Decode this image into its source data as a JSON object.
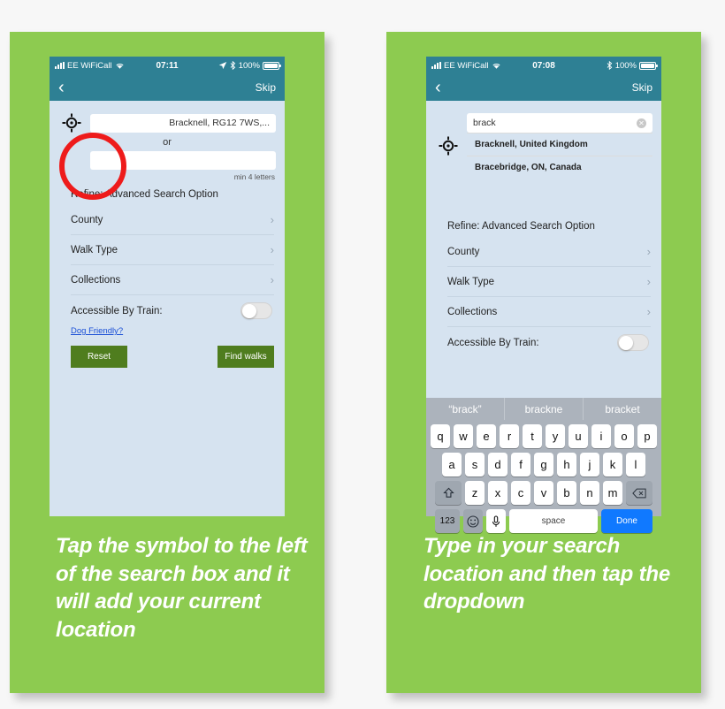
{
  "panels": [
    {
      "id": "left",
      "status_bar": {
        "carrier": "EE WiFiCall",
        "wifi_icon": "wifi-icon",
        "time": "07:11",
        "location_icon": "location-arrow-icon",
        "bluetooth_icon": "bluetooth-icon",
        "battery_text": "100%",
        "battery_icon": "battery-icon"
      },
      "nav": {
        "back_icon": "chevron-left-icon",
        "skip_label": "Skip"
      },
      "search": {
        "target_icon": "crosshair-target-icon",
        "location_value": "Bracknell, RG12 7WS,...",
        "or_label": "or",
        "second_input_value": "",
        "second_input_placeholder": "",
        "hint": "min 4 letters"
      },
      "refine_title": "Refine: Advanced Search Option",
      "rows": [
        {
          "label": "County",
          "chevron": "chevron-right-icon"
        },
        {
          "label": "Walk Type",
          "chevron": "chevron-right-icon"
        },
        {
          "label": "Collections",
          "chevron": "chevron-right-icon"
        }
      ],
      "train": {
        "label": "Accessible By Train:",
        "toggle_state": "off"
      },
      "dog_link": "Dog Friendly?",
      "buttons": {
        "reset": "Reset",
        "find": "Find walks"
      },
      "annotation": "red-highlight-circle",
      "caption": "Tap the symbol to the left of the search box and it will add your current location"
    },
    {
      "id": "right",
      "status_bar": {
        "carrier": "EE WiFiCall",
        "wifi_icon": "wifi-icon",
        "time": "07:08",
        "bluetooth_icon": "bluetooth-icon",
        "battery_text": "100%",
        "battery_icon": "battery-icon"
      },
      "nav": {
        "back_icon": "chevron-left-icon",
        "skip_label": "Skip"
      },
      "search": {
        "target_icon": "crosshair-target-icon",
        "query_value": "brack",
        "clear_icon": "clear-circle-icon",
        "suggestions": [
          "Bracknell, United Kingdom",
          "Bracebridge, ON, Canada"
        ]
      },
      "refine_title": "Refine: Advanced Search Option",
      "rows": [
        {
          "label": "County",
          "chevron": "chevron-right-icon"
        },
        {
          "label": "Walk Type",
          "chevron": "chevron-right-icon"
        },
        {
          "label": "Collections",
          "chevron": "chevron-right-icon"
        }
      ],
      "train": {
        "label": "Accessible By Train:",
        "toggle_state": "off"
      },
      "keyboard": {
        "predictions": [
          "“brack”",
          "brackne",
          "bracket"
        ],
        "row1": [
          "q",
          "w",
          "e",
          "r",
          "t",
          "y",
          "u",
          "i",
          "o",
          "p"
        ],
        "row2": [
          "a",
          "s",
          "d",
          "f",
          "g",
          "h",
          "j",
          "k",
          "l"
        ],
        "row3": [
          "z",
          "x",
          "c",
          "v",
          "b",
          "n",
          "m"
        ],
        "shift_icon": "shift-arrow-icon",
        "backspace_icon": "backspace-icon",
        "numbers_label": "123",
        "emoji_icon": "smiley-face-icon",
        "mic_icon": "microphone-icon",
        "space_label": "space",
        "done_label": "Done"
      },
      "caption": "Type in your search location and then tap the dropdown"
    }
  ],
  "colors": {
    "card_green": "#8DCB50",
    "header_teal": "#2E8094",
    "screen_blue": "#D6E3F0",
    "button_olive": "#4F7D1E",
    "annotation_red": "#EE1B1B",
    "done_blue": "#1079FF",
    "link_blue": "#1A4FD6"
  }
}
